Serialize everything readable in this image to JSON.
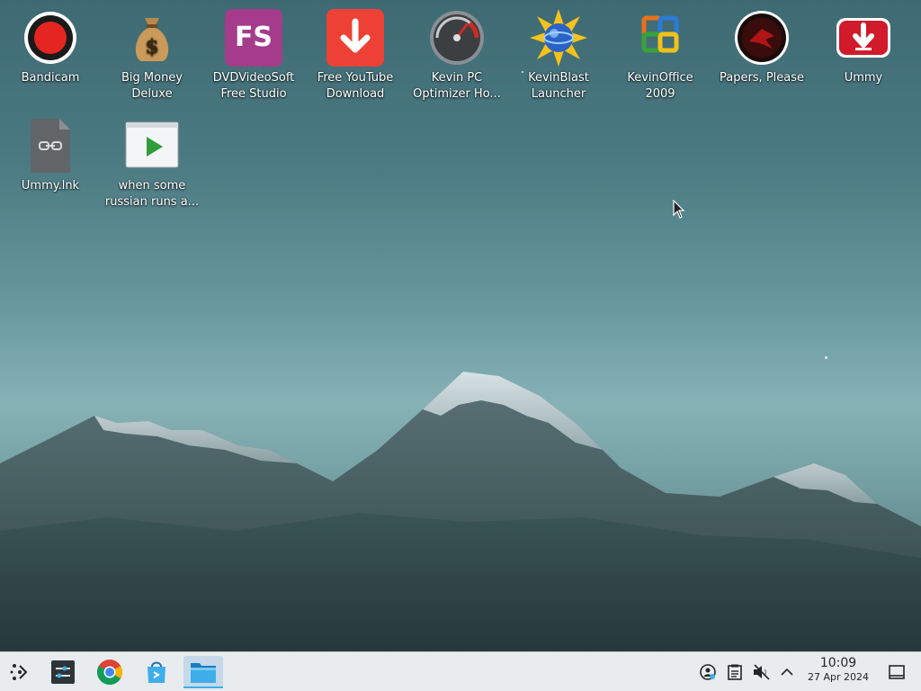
{
  "desktop": {
    "icons": [
      {
        "label": "Bandicam",
        "icon": "bandicam-record-icon"
      },
      {
        "label": "Big Money\nDeluxe",
        "icon": "money-bag-icon"
      },
      {
        "label": "DVDVideoSoft\nFree Studio",
        "icon": "fs-logo-icon",
        "icon_text": "FS"
      },
      {
        "label": "Free YouTube\nDownload",
        "icon": "download-arrow-icon"
      },
      {
        "label": "Kevin PC\nOptimizer Ho...",
        "icon": "speedometer-icon"
      },
      {
        "label": "KevinBlast\nLauncher",
        "icon": "sun-globe-icon"
      },
      {
        "label": "KevinOffice\n2009",
        "icon": "office-logo-icon"
      },
      {
        "label": "Papers, Please",
        "icon": "papers-please-emblem-icon"
      },
      {
        "label": "Ummy",
        "icon": "ummy-download-icon"
      },
      {
        "label": "Ummy.lnk",
        "icon": "link-file-icon"
      },
      {
        "label": "when some\nrussian runs a...",
        "icon": "video-file-icon"
      }
    ]
  },
  "taskbar": {
    "launcher_icon": "app-launcher-icon",
    "apps": [
      {
        "name": "system-settings",
        "icon": "settings-sliders-icon"
      },
      {
        "name": "chrome",
        "icon": "chrome-icon"
      },
      {
        "name": "discover-store",
        "icon": "store-bag-icon"
      },
      {
        "name": "file-manager",
        "icon": "folder-icon",
        "active": true
      }
    ],
    "tray": [
      "network-icon",
      "clipboard-icon",
      "volume-muted-icon",
      "expand-tray-icon"
    ],
    "clock": {
      "time": "10:09",
      "date": "27 Apr 2024"
    },
    "show_desktop_icon": "show-desktop-icon"
  },
  "colors": {
    "accent": "#3daee9",
    "taskbar_bg": "#e9ecee",
    "sky_top": "#3e6a73"
  }
}
